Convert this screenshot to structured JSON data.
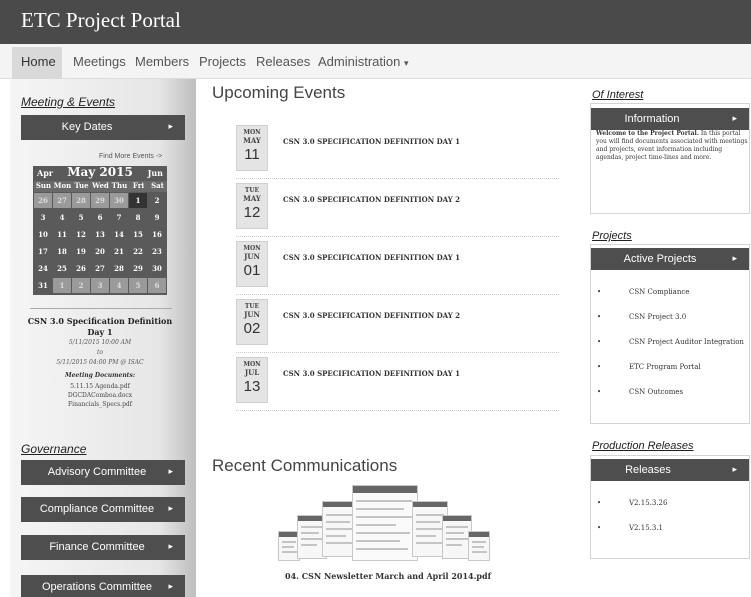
{
  "app": {
    "title": "ETC Project Portal"
  },
  "nav": {
    "items": [
      {
        "label": "Home"
      },
      {
        "label": "Meetings"
      },
      {
        "label": "Members"
      },
      {
        "label": "Projects"
      },
      {
        "label": "Releases"
      },
      {
        "label": "Administration"
      }
    ],
    "dropdown_icon": "caret-down-icon"
  },
  "sidebar": {
    "meetings_title": "Meeting & Events",
    "key_dates_button": "Key Dates",
    "find_more": "Find More Events ->",
    "calendar": {
      "prev": "Apr",
      "month": "May 2015",
      "next": "Jun",
      "days_of_week": [
        "Sun",
        "Mon",
        "Tue",
        "Wed",
        "Thu",
        "Fri",
        "Sat"
      ],
      "weeks": [
        [
          "26",
          "27",
          "28",
          "29",
          "30",
          "1",
          "2"
        ],
        [
          "3",
          "4",
          "5",
          "6",
          "7",
          "8",
          "9"
        ],
        [
          "10",
          "11",
          "12",
          "13",
          "14",
          "15",
          "16"
        ],
        [
          "17",
          "18",
          "19",
          "20",
          "21",
          "22",
          "23"
        ],
        [
          "24",
          "25",
          "26",
          "27",
          "28",
          "29",
          "30"
        ],
        [
          "31",
          "1",
          "2",
          "3",
          "4",
          "5",
          "6"
        ]
      ]
    },
    "event": {
      "title": "CSN 3.0 Specification Definition Day 1",
      "start": "5/11/2015 10:00 AM",
      "to": "to",
      "end": "5/11/2015 04:00 PM @ ISAC",
      "docs_label": "Meeting Documents:",
      "docs": [
        "5.11.15 Agenda.pdf",
        "DGCDAComboa.docx",
        "Financials_Specs.pdf"
      ]
    },
    "governance_title": "Governance",
    "committees": [
      {
        "label": "Advisory Committee"
      },
      {
        "label": "Compliance Committee"
      },
      {
        "label": "Finance Committee"
      },
      {
        "label": "Operations Committee"
      }
    ]
  },
  "main": {
    "upcoming_title": "Upcoming Events",
    "events": [
      {
        "dow": "MON",
        "month": "MAY",
        "day": "11",
        "name": "CSN 3.0 SPECIFICATION DEFINITION DAY 1"
      },
      {
        "dow": "TUE",
        "month": "MAY",
        "day": "12",
        "name": "CSN 3.0 SPECIFICATION DEFINITION DAY 2"
      },
      {
        "dow": "MON",
        "month": "JUN",
        "day": "01",
        "name": "CSN 3.0 SPECIFICATION DEFINITION DAY 1"
      },
      {
        "dow": "TUE",
        "month": "JUN",
        "day": "02",
        "name": "CSN 3.0 SPECIFICATION DEFINITION DAY 2"
      },
      {
        "dow": "MON",
        "month": "JUL",
        "day": "13",
        "name": "CSN 3.0 SPECIFICATION DEFINITION DAY 1"
      }
    ],
    "communications_title": "Recent Communications",
    "newsletter_caption": "04. CSN Newsletter March and April 2014.pdf"
  },
  "right": {
    "interest_title": "Of Interest",
    "information_button": "Information",
    "information_text_bold": "Welcome to the Project Portal.",
    "information_text": "In this portal you will find documents associated with meetings and projects, event information including agendas, project time-lines and more.",
    "projects_title": "Projects",
    "active_projects_button": "Active Projects",
    "projects": [
      "CSN Compliance",
      "CSN Project 3.0",
      "CSN Project Auditor Integration",
      "ETC Program Portal",
      "CSN Outcomes"
    ],
    "releases_title": "Production Releases",
    "releases_button": "Releases",
    "releases": [
      "V2.15.3.26",
      "V2.15.3.1"
    ]
  },
  "colors": {
    "topbar": "#4a4a4a",
    "button_dark": "#4e4e4e",
    "calendar_bg": "#5a5a5a"
  }
}
